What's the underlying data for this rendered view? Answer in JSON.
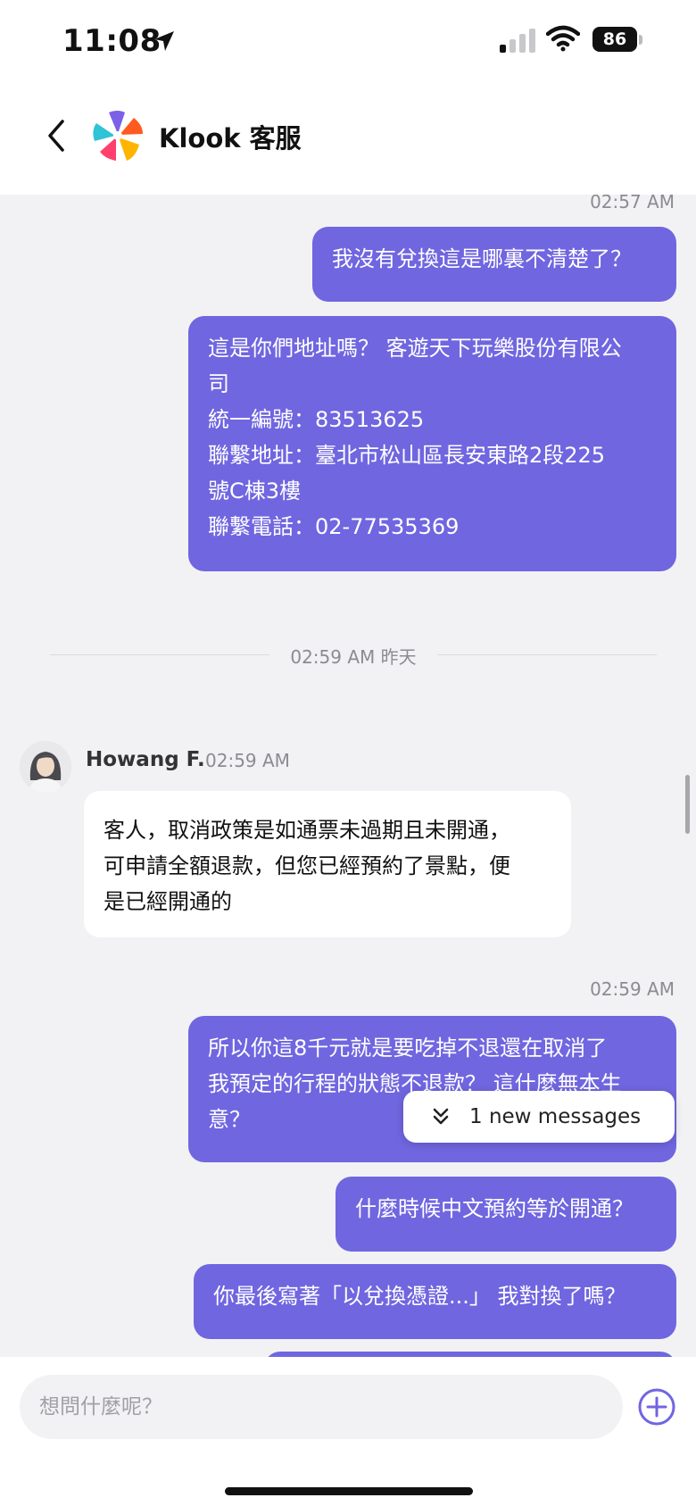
{
  "status_bar": {
    "time": "11:08",
    "battery": "86"
  },
  "header": {
    "title": "Klook 客服"
  },
  "messages": {
    "ts1": "02:57 AM",
    "m1": "我沒有兌換這是哪裏不清楚了？",
    "m2": "這是你們地址嗎？ 客遊天下玩樂股份有限公\n司\n統一編號：83513625\n聯繫地址：臺北市松山區長安東路2段225\n號C棟3樓\n聯繫電話：02-77535369",
    "divider": "02:59 AM 昨天",
    "agent_name": "Howang F.",
    "agent_time": "02:59 AM",
    "m3": "客人，取消政策是如通票未過期且未開通，\n可申請全額退款，但您已經預約了景點，便\n是已經開通的",
    "ts2": "02:59 AM",
    "m4": "所以你這8千元就是要吃掉不退還在取消了\n我預定的行程的狀態不退款？ 這什麼無本生\n意？",
    "m5": "什麼時候中文預約等於開通？",
    "m6": "你最後寫著「以兌換憑證...」 我對換了嗎？"
  },
  "new_messages": "1 new messages",
  "composer": {
    "placeholder": "想問什麼呢？"
  },
  "colors": {
    "accent": "#7066e0",
    "background": "#f2f2f4"
  },
  "icons": [
    "location-arrow-icon",
    "signal-icon",
    "wifi-icon",
    "battery-icon",
    "back-chevron-icon",
    "klook-logo-icon",
    "double-chevron-down-icon",
    "plus-circle-icon"
  ]
}
